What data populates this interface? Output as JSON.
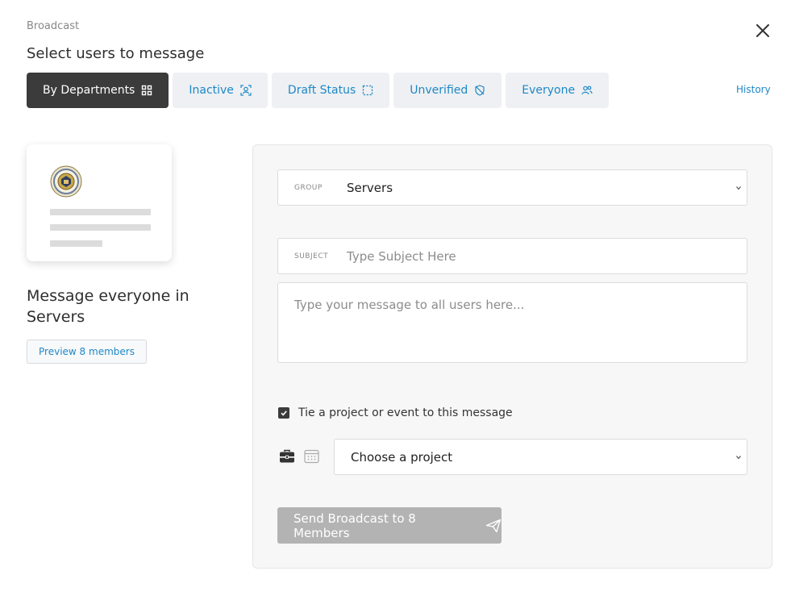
{
  "header": {
    "breadcrumb": "Broadcast",
    "title": "Select users to message",
    "close_icon": "close-icon"
  },
  "tabs": [
    {
      "label": "By Departments",
      "icon": "grid-icon",
      "active": true
    },
    {
      "label": "Inactive",
      "icon": "user-scan-icon",
      "active": false
    },
    {
      "label": "Draft Status",
      "icon": "dashed-square-icon",
      "active": false
    },
    {
      "label": "Unverified",
      "icon": "shield-off-icon",
      "active": false
    },
    {
      "label": "Everyone",
      "icon": "users-icon",
      "active": false
    }
  ],
  "history_link": "History",
  "left": {
    "heading_line1": "Message everyone in",
    "heading_line2": "Servers",
    "preview_button": "Preview 8 members"
  },
  "form": {
    "group_label": "GROUP",
    "group_value": "Servers",
    "subject_label": "SUBJECT",
    "subject_placeholder": "Type Subject Here",
    "message_placeholder": "Type your message to all users here...",
    "tie_checkbox_checked": true,
    "tie_label": "Tie a project or event to this message",
    "project_placeholder": "Choose a project",
    "send_button": "Send Broadcast to 8 Members"
  },
  "colors": {
    "accent": "#1e88c7",
    "active_tab": "#3b3b3b",
    "disabled_button": "#b3b3b3"
  }
}
